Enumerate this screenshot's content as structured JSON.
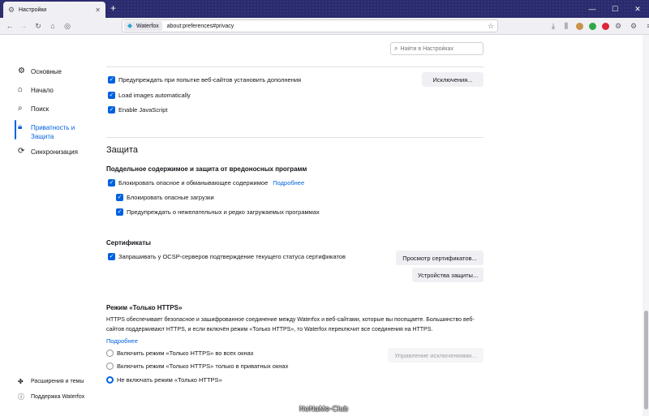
{
  "window": {
    "tab_title": "Настройки",
    "new_tab_glyph": "+",
    "controls": {
      "minimize": "—",
      "maximize": "☐",
      "close": "✕"
    }
  },
  "navbar": {
    "identity_label": "Waterfox",
    "url": "about:preferences#privacy",
    "icons": [
      "back-icon",
      "forward-icon",
      "reload-icon",
      "home-icon",
      "reader-icon"
    ],
    "toolbar_icons": [
      "download-icon",
      "library-icon",
      "sidebar-icon",
      "extension-icon",
      "extension-icon",
      "extension-icon",
      "extension-icon",
      "settings-icon",
      "menu-icon"
    ]
  },
  "search": {
    "placeholder": "Найти в Настройках"
  },
  "sidebar": {
    "items": [
      {
        "label": "Основные",
        "icon": "gear-icon"
      },
      {
        "label": "Начало",
        "icon": "home-icon"
      },
      {
        "label": "Поиск",
        "icon": "search-icon"
      },
      {
        "label": "Приватность и Защита",
        "icon": "lock-icon"
      },
      {
        "label": "Синхронизация",
        "icon": "sync-icon"
      }
    ],
    "footer": [
      {
        "label": "Расширения и темы",
        "icon": "puzzle-icon"
      },
      {
        "label": "Поддержка Waterfox",
        "icon": "help-icon"
      }
    ]
  },
  "permissions": {
    "warn_addons": "Предупреждать при попытке веб-сайтов установить дополнения",
    "exceptions_button": "Исключения...",
    "load_images": "Load images automatically",
    "enable_js": "Enable JavaScript"
  },
  "security": {
    "title": "Защита",
    "deceptive": {
      "heading": "Поддельное содержимое и защита от вредоносных программ",
      "block_dangerous": "Блокировать опасное и обманывающее содержимое",
      "learn_more": "Подробнее",
      "block_downloads": "Блокировать опасные загрузки",
      "warn_unwanted": "Предупреждать о нежелательных и редко загружаемых программах"
    },
    "certificates": {
      "heading": "Сертификаты",
      "ocsp": "Запрашивать у OCSP-серверов подтверждение текущего статуса сертификатов",
      "view_button": "Просмотр сертификатов...",
      "devices_button": "Устройства защиты..."
    },
    "https": {
      "heading": "Режим «Только HTTPS»",
      "description": "HTTPS обеспечивает безопасное и зашифрованное соединение между Waterfox и веб-сайтами, которые вы посещаете. Большинство веб-сайтов поддерживают HTTPS, и если включён режим «Только HTTPS», то Waterfox переключит все соединения на HTTPS.",
      "learn_more": "Подробнее",
      "options": [
        "Включить режим «Только HTTPS» во всех окнах",
        "Включить режим «Только HTTPS» только в приватных окнах",
        "Не включать режим «Только HTTPS»"
      ],
      "selected_index": 2,
      "manage_button": "Управление исключениями..."
    }
  },
  "watermark": "NoNaMe-Club",
  "colors": {
    "accent": "#0061e0",
    "tabbar": "#2a2a6e"
  }
}
